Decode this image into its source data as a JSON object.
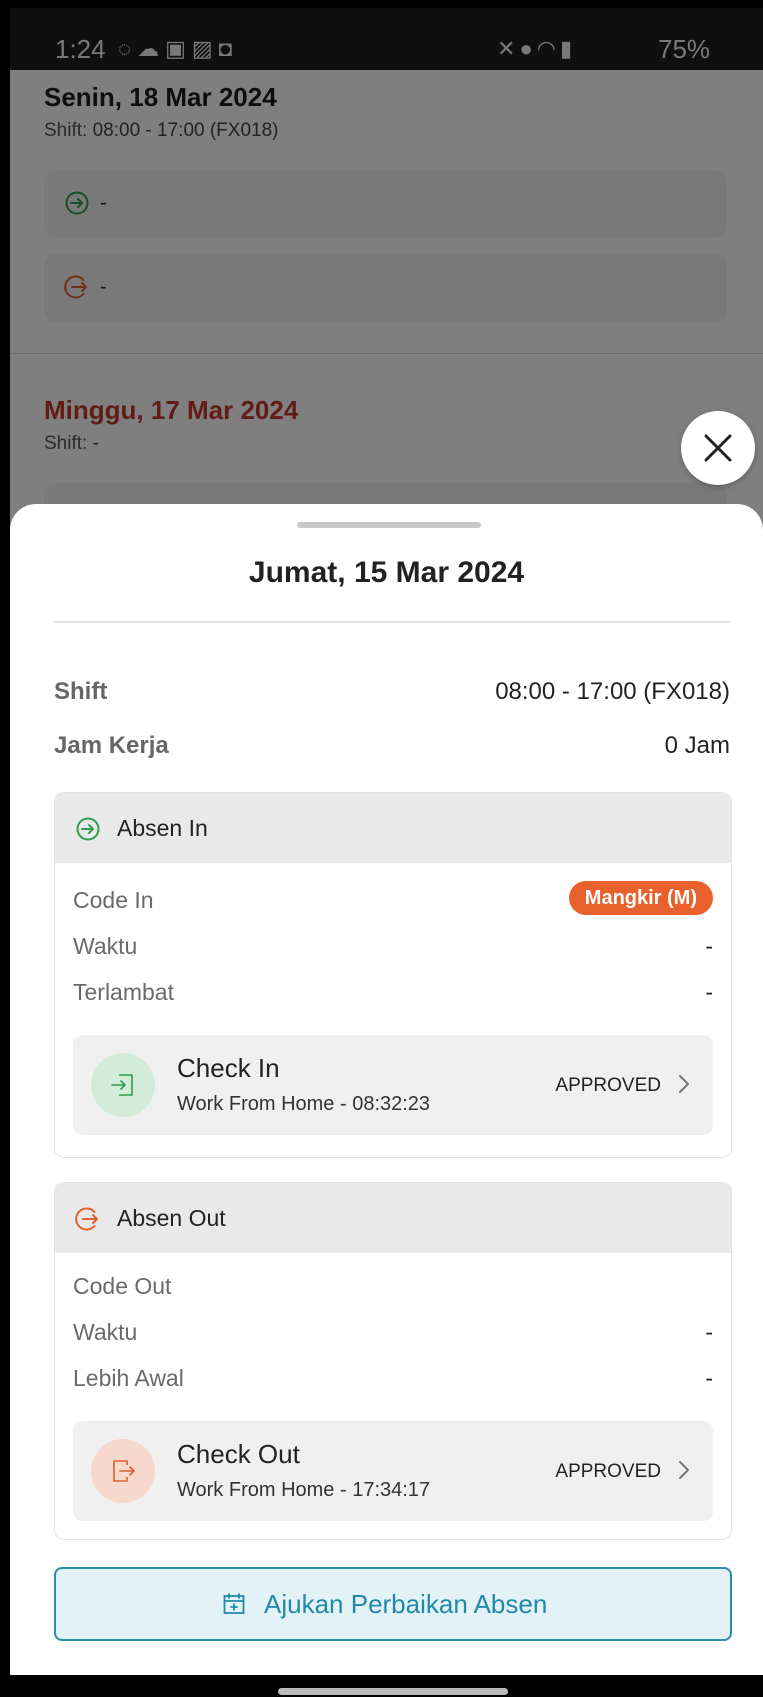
{
  "status_bar": {
    "time": "1:24",
    "battery": "75%",
    "left_icons": [
      "whatsapp-icon",
      "cloud-icon",
      "app-icon",
      "gallery-icon",
      "bag-icon"
    ],
    "right_icons": [
      "mute-icon",
      "location-icon",
      "wifi-icon",
      "signal-icon"
    ]
  },
  "background_days": [
    {
      "date": "Senin, 18 Mar 2024",
      "shift_label": "Shift:",
      "shift_value": "08:00 - 17:00 (FX018)",
      "in_value": "-",
      "out_value": "-"
    },
    {
      "date": "Minggu, 17 Mar 2024",
      "shift_label": "Shift:",
      "shift_value": "-"
    }
  ],
  "sheet": {
    "title": "Jumat, 15 Mar 2024",
    "shift_label": "Shift",
    "shift_value": "08:00 - 17:00 (FX018)",
    "work_hours_label": "Jam Kerja",
    "work_hours_value": "0 Jam",
    "absen_in": {
      "header": "Absen In",
      "code_label": "Code In",
      "code_badge": "Mangkir (M)",
      "time_label": "Waktu",
      "time_value": "-",
      "late_label": "Terlambat",
      "late_value": "-",
      "entry_title": "Check In",
      "entry_sub": "Work From Home - 08:32:23",
      "entry_status": "APPROVED"
    },
    "absen_out": {
      "header": "Absen Out",
      "code_label": "Code Out",
      "time_label": "Waktu",
      "time_value": "-",
      "early_label": "Lebih Awal",
      "early_value": "-",
      "entry_title": "Check Out",
      "entry_sub": "Work From Home - 17:34:17",
      "entry_status": "APPROVED"
    },
    "action_label": "Ajukan Perbaikan Absen"
  },
  "colors": {
    "in_green": "#2e9d4f",
    "out_orange": "#e0602c",
    "badge": "#e8612c",
    "action": "#2289a8",
    "weekend_red": "#c0392b"
  }
}
